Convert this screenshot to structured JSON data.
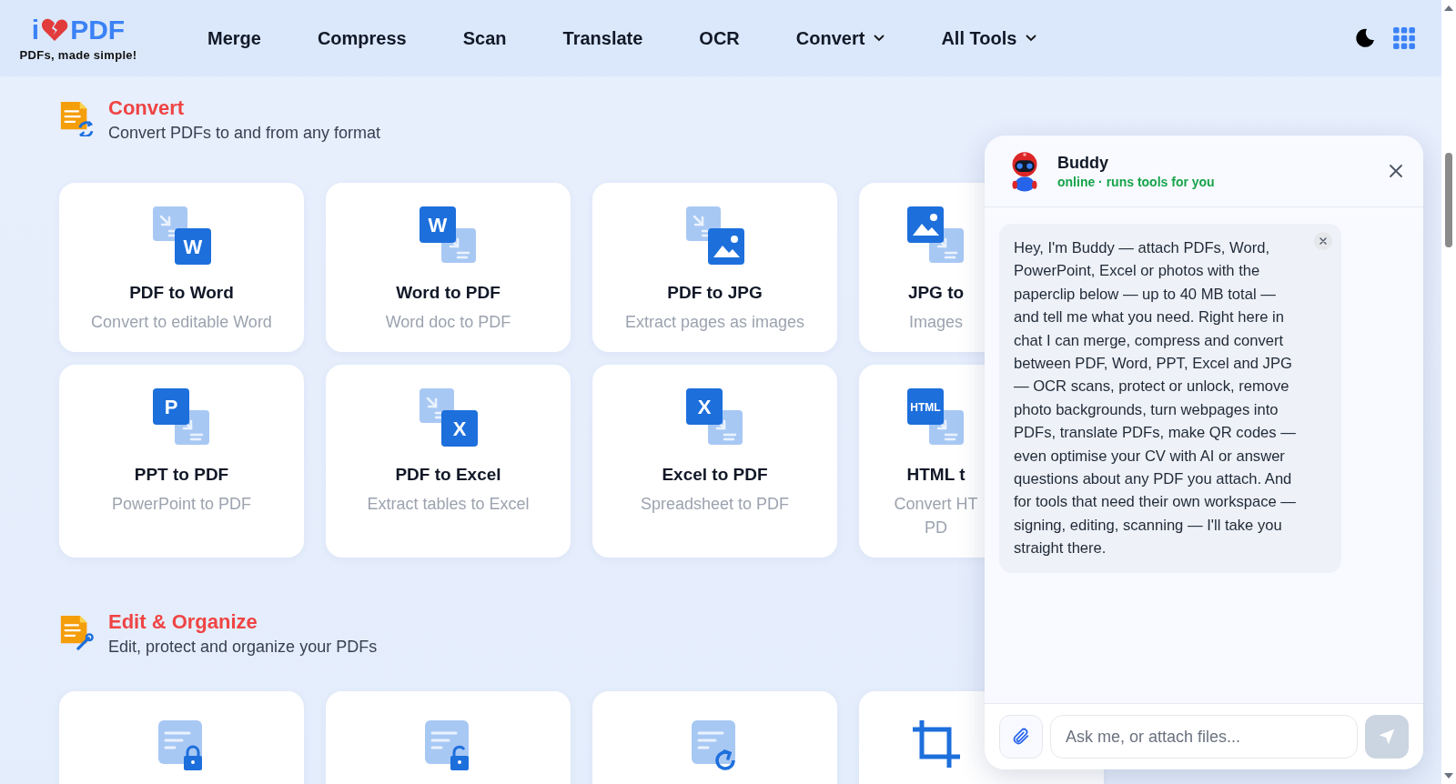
{
  "header": {
    "logo": {
      "left": "i",
      "right": "PDF",
      "tagline": "PDFs, made simple!"
    },
    "nav": [
      {
        "label": "Merge",
        "dropdown": false
      },
      {
        "label": "Compress",
        "dropdown": false
      },
      {
        "label": "Scan",
        "dropdown": false
      },
      {
        "label": "Translate",
        "dropdown": false
      },
      {
        "label": "OCR",
        "dropdown": false
      },
      {
        "label": "Convert",
        "dropdown": true
      },
      {
        "label": "All Tools",
        "dropdown": true
      }
    ]
  },
  "sections": [
    {
      "title": "Convert",
      "subtitle": "Convert PDFs to and from any format",
      "cards": [
        {
          "icon": {
            "kind": "from_pdf",
            "badge": "W"
          },
          "title": "PDF to Word",
          "desc": "Convert to editable Word"
        },
        {
          "icon": {
            "kind": "to_pdf",
            "badge": "W"
          },
          "title": "Word to PDF",
          "desc": "Word doc to PDF"
        },
        {
          "icon": {
            "kind": "from_pdf"
          },
          "title": "PDF to JPG",
          "desc": "Extract pages as images"
        },
        {
          "icon": {
            "kind": "to_pdf"
          },
          "title": "JPG to",
          "desc": "Images"
        },
        {
          "icon": {
            "kind": "to_pdf",
            "badge": "P"
          },
          "title": "PPT to PDF",
          "desc": "PowerPoint to PDF"
        },
        {
          "icon": {
            "kind": "from_pdf",
            "badge": "X"
          },
          "title": "PDF to Excel",
          "desc": "Extract tables to Excel"
        },
        {
          "icon": {
            "kind": "to_pdf",
            "badge": "X"
          },
          "title": "Excel to PDF",
          "desc": "Spreadsheet to PDF"
        },
        {
          "icon": {
            "kind": "to_pdf",
            "badge": "HTML"
          },
          "title": "HTML t",
          "desc": "Convert HT\nPD"
        }
      ]
    },
    {
      "title": "Edit & Organize",
      "subtitle": "Edit, protect and organize your PDFs",
      "cards": [
        {
          "icon": {
            "kind": "lock"
          }
        },
        {
          "icon": {
            "kind": "unlock"
          }
        },
        {
          "icon": {
            "kind": "rotate"
          }
        },
        {
          "icon": {
            "kind": "crop"
          }
        }
      ]
    }
  ],
  "chat": {
    "name": "Buddy",
    "status": "online · runs tools for you",
    "messages": [
      {
        "text": "Hey, I'm Buddy — attach PDFs, Word, PowerPoint, Excel or photos with the paperclip below — up to 40 MB total — and tell me what you need. Right here in chat I can merge, compress and convert between PDF, Word, PPT, Excel and JPG — OCR scans, protect or unlock, remove photo backgrounds, turn webpages into PDFs, translate PDFs, make QR codes — even optimise your CV with AI or answer questions about any PDF you attach. And for tools that need their own workspace — signing, editing, scanning — I'll take you straight there."
      }
    ],
    "input": {
      "placeholder": "Ask me, or attach files..."
    },
    "send": {
      "disabled": true
    }
  }
}
